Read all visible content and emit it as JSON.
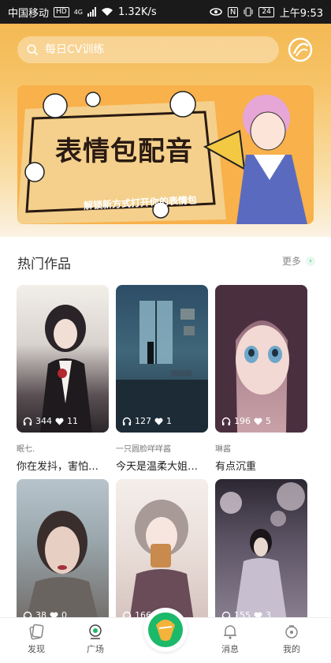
{
  "status_bar": {
    "carrier": "中国移动",
    "hd_badge": "HD",
    "signal_badge": "4G",
    "speed": "1.32K/s",
    "nfc": "N",
    "battery": "24",
    "time": "上午9:53"
  },
  "search": {
    "placeholder": "每日CV训练"
  },
  "banner": {
    "title": "表情包配音",
    "subtitle": "解锁新方式打开你的表情包"
  },
  "section": {
    "title": "热门作品",
    "more_label": "更多",
    "more_arrow": "›"
  },
  "cards": [
    {
      "plays": "344",
      "likes": "11",
      "author": "眠七.",
      "name": "你在发抖，害怕我，..."
    },
    {
      "plays": "127",
      "likes": "1",
      "author": "一只圆脸咩咩酱",
      "name": "今天是温柔大姐姐哄..."
    },
    {
      "plays": "196",
      "likes": "5",
      "author": "琳酱",
      "name": "有点沉重"
    },
    {
      "plays": "38",
      "likes": "0",
      "author": "",
      "name": ""
    },
    {
      "plays": "166",
      "likes": "",
      "author": "",
      "name": ""
    },
    {
      "plays": "155",
      "likes": "3",
      "author": "",
      "name": ""
    }
  ],
  "nav": {
    "discover": "发现",
    "square": "广场",
    "messages": "消息",
    "mine": "我的"
  },
  "colors": {
    "accent": "#1db96a",
    "banner_bg": "#f8b14b"
  }
}
